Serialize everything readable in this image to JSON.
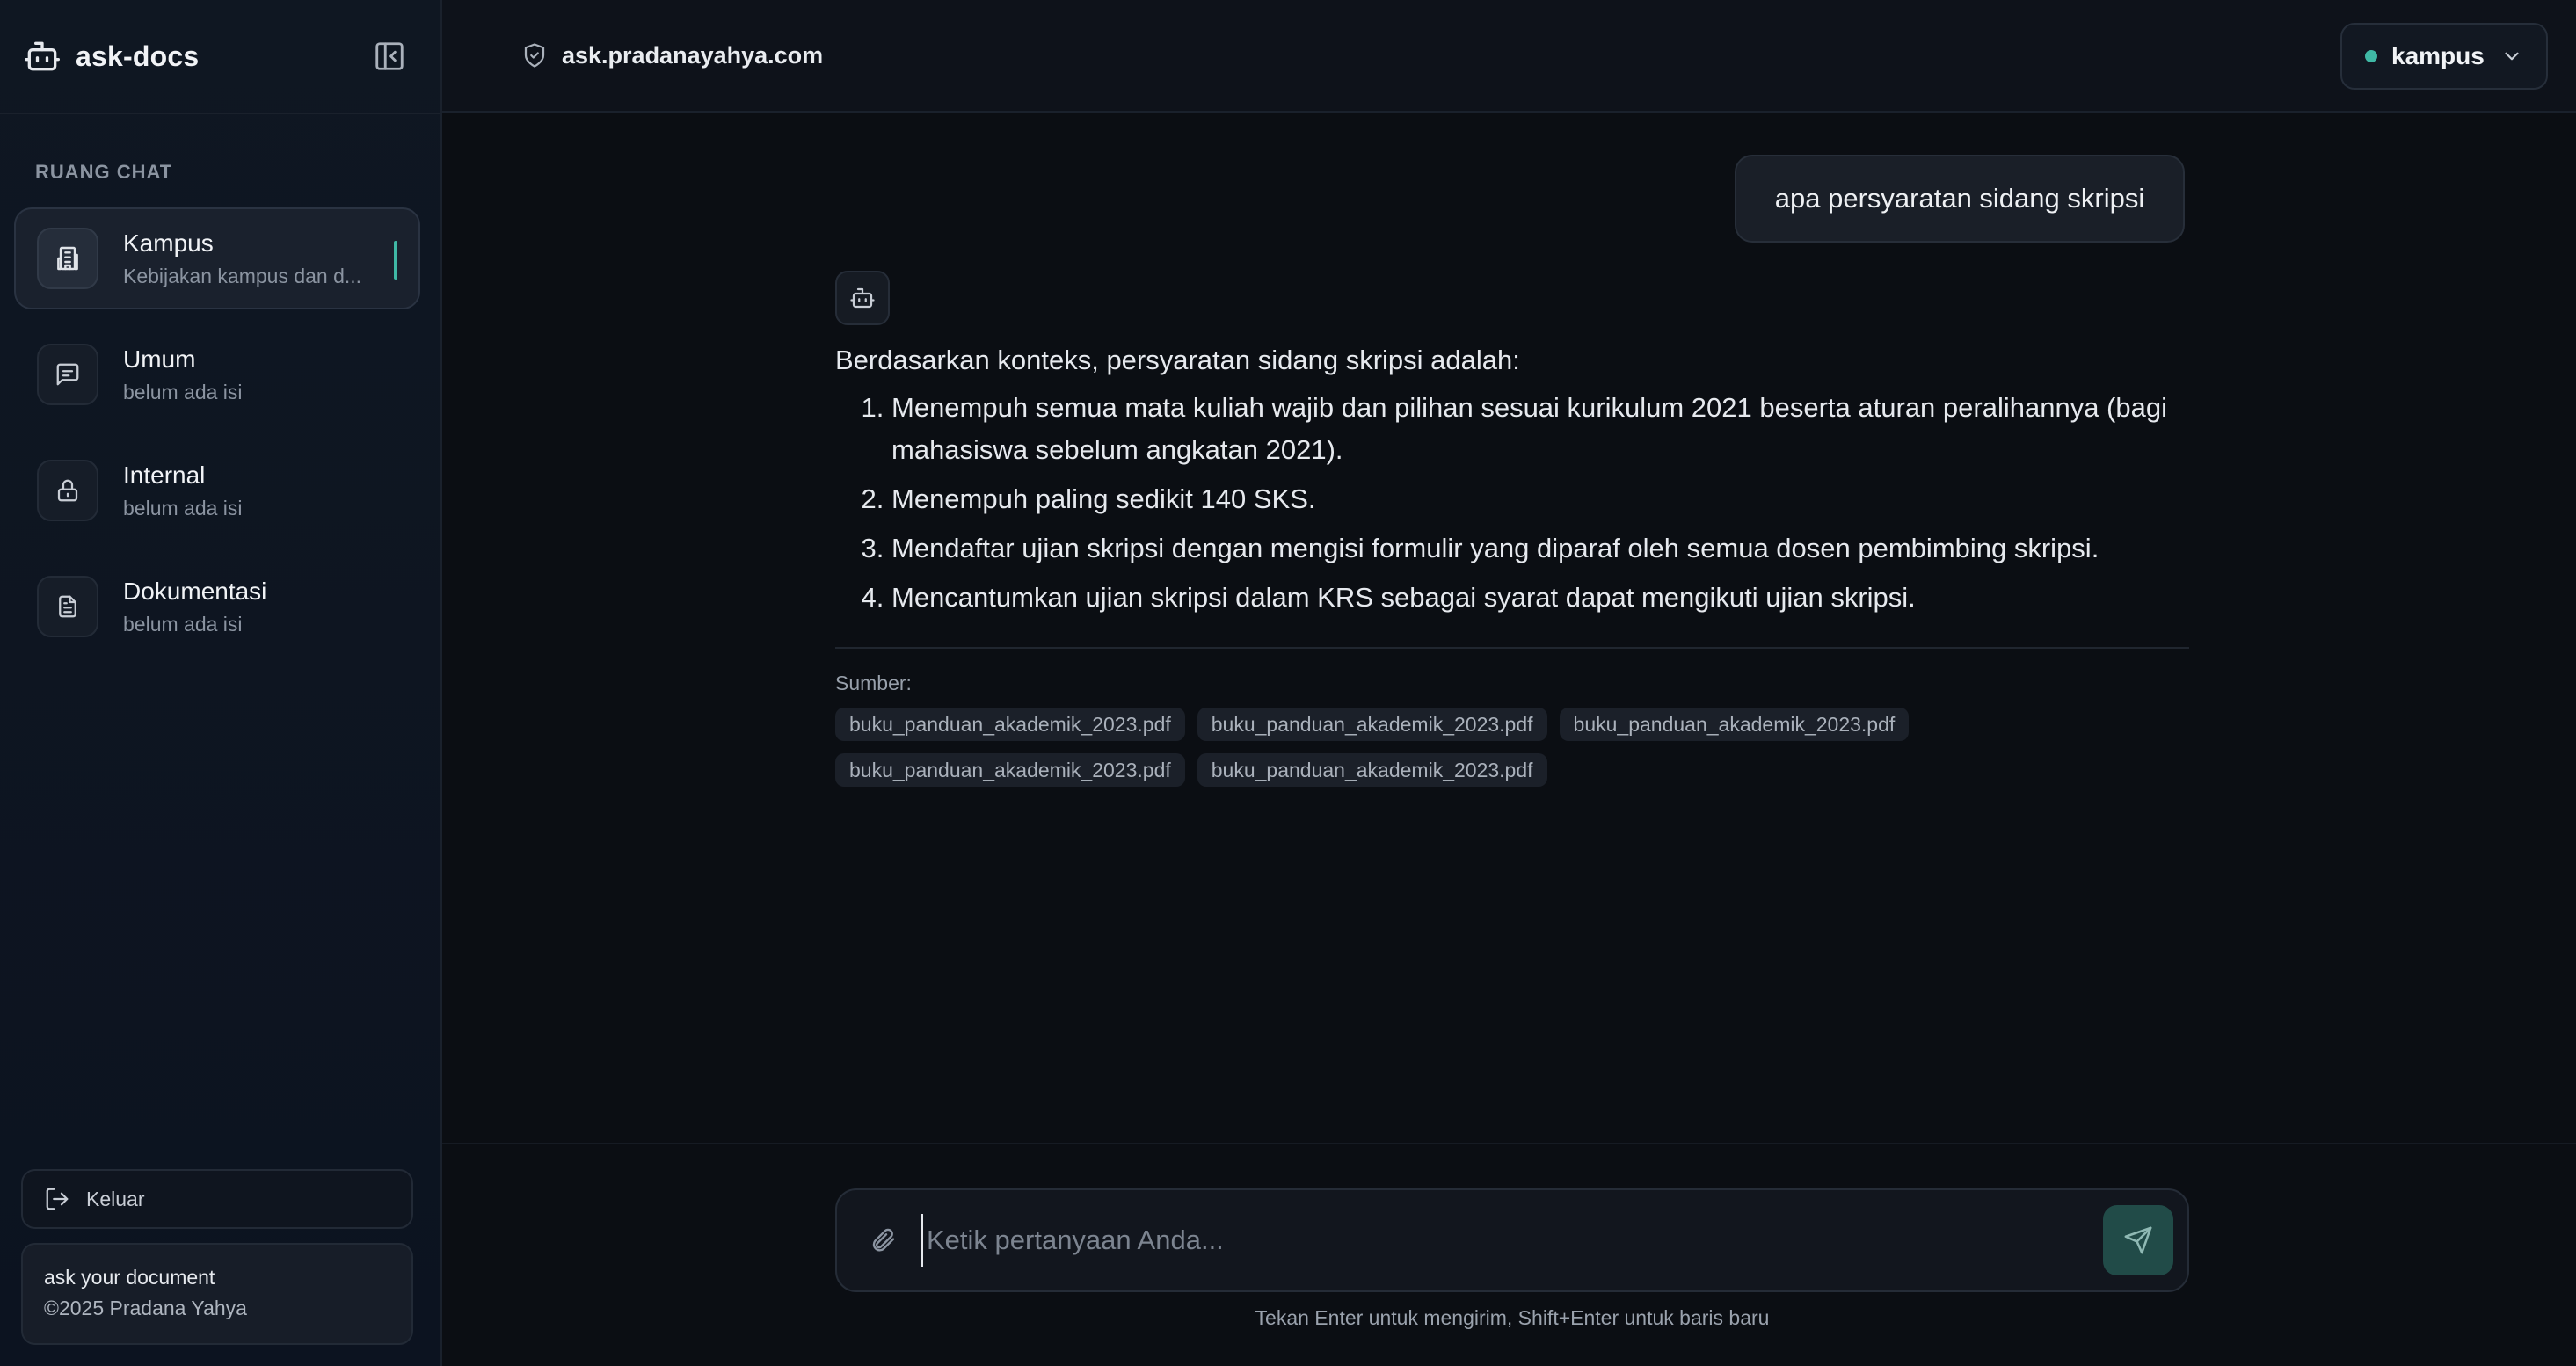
{
  "app": {
    "name": "ask-docs",
    "icons": {
      "brand": "robot-icon",
      "collapse": "sidebar-collapse-icon"
    }
  },
  "sidebar": {
    "section_title": "RUANG CHAT",
    "rooms": [
      {
        "title": "Kampus",
        "subtitle": "Kebijakan kampus dan d...",
        "icon": "building-icon",
        "active": true
      },
      {
        "title": "Umum",
        "subtitle": "belum ada isi",
        "icon": "chat-icon",
        "active": false
      },
      {
        "title": "Internal",
        "subtitle": "belum ada isi",
        "icon": "lock-icon",
        "active": false
      },
      {
        "title": "Dokumentasi",
        "subtitle": "belum ada isi",
        "icon": "document-icon",
        "active": false
      }
    ],
    "logout_label": "Keluar",
    "footer": {
      "line1": "ask your document",
      "line2": "©2025 Pradana Yahya"
    }
  },
  "topbar": {
    "domain": "ask.pradanayahya.com",
    "room_select": {
      "label": "kampus",
      "status_color": "#3fb8a5"
    }
  },
  "chat": {
    "user_message": "apa persyaratan sidang skripsi",
    "answer_intro": "Berdasarkan konteks, persyaratan sidang skripsi adalah:",
    "answer_items": [
      "Menempuh semua mata kuliah wajib dan pilihan sesuai kurikulum 2021 beserta aturan peralihannya (bagi mahasiswa sebelum angkatan 2021).",
      "Menempuh paling sedikit 140 SKS.",
      "Mendaftar ujian skripsi dengan mengisi formulir yang diparaf oleh semua dosen pembimbing skripsi.",
      "Mencantumkan ujian skripsi dalam KRS sebagai syarat dapat mengikuti ujian skripsi."
    ],
    "sources_label": "Sumber:",
    "sources": [
      "buku_panduan_akademik_2023.pdf",
      "buku_panduan_akademik_2023.pdf",
      "buku_panduan_akademik_2023.pdf",
      "buku_panduan_akademik_2023.pdf",
      "buku_panduan_akademik_2023.pdf"
    ]
  },
  "composer": {
    "placeholder": "Ketik pertanyaan Anda...",
    "value": "",
    "hint": "Tekan Enter untuk mengirim, Shift+Enter untuk baris baru"
  },
  "colors": {
    "accent": "#3fb8a5",
    "send_button": "#214b48"
  }
}
